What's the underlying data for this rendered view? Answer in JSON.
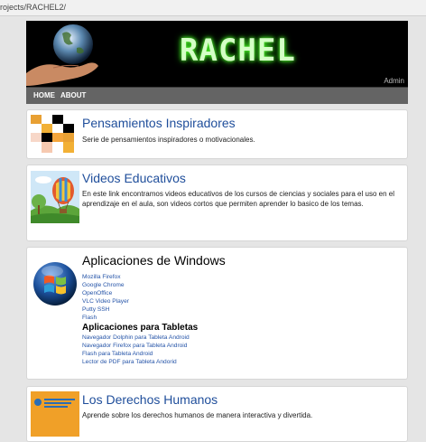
{
  "browser": {
    "url_fragment": "rojects/RACHEL2/"
  },
  "header": {
    "logo": "RACHEL",
    "admin_link": "Admin"
  },
  "nav": {
    "items": [
      "HOME",
      "ABOUT"
    ]
  },
  "cards": [
    {
      "title": "Pensamientos Inspiradores",
      "description": "Serie de pensamientos inspiradores o motivacionales."
    },
    {
      "title": "Videos Educativos",
      "description": "En este link encontramos videos educativos de los cursos de ciencias y sociales para el uso en el aprendizaje en el aula, son videos cortos que permiten aprender lo basico de los temas."
    },
    {
      "title": "Aplicaciones de Windows",
      "links": [
        "Mozilla Firefox",
        "Google Chrome",
        "OpenOffice",
        "VLC Video Player",
        "Putty SSH",
        "Flash"
      ],
      "subheading": "Aplicaciones para Tabletas",
      "tablet_links": [
        "Navegador Dolphin para Tableta Android",
        "Navegador Firefox para Tableta Android",
        "Flash para Tableta Android",
        "Lector de PDF para Tableta Andorid"
      ]
    },
    {
      "title": "Los Derechos Humanos",
      "description": "Aprende sobre los derechos humanos de manera interactiva y divertida."
    }
  ]
}
